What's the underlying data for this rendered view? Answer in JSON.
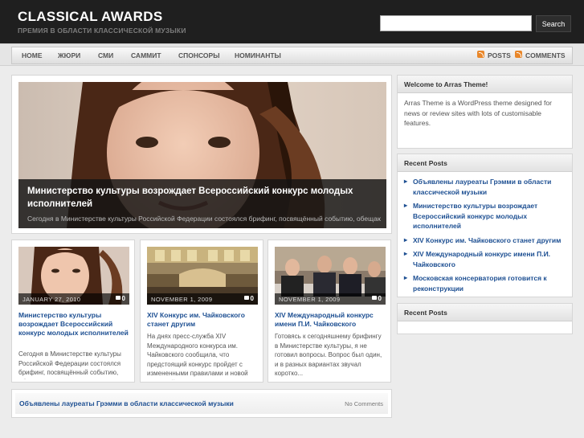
{
  "site": {
    "title": "CLASSICAL AWARDS",
    "description": "ПРЕМИЯ В ОБЛАСТИ КЛАССИЧЕСКОЙ МУЗЫКИ"
  },
  "search": {
    "placeholder": "",
    "button_label": "Search"
  },
  "nav": {
    "items": [
      "HOME",
      "ЖЮРИ",
      "СМИ",
      "САММИТ",
      "СПОНСОРЫ",
      "НОМИНАНТЫ"
    ],
    "feeds": [
      "POSTS",
      "COMMENTS"
    ]
  },
  "featured": {
    "title": "Министерство культуры возрождает Всероссийский конкурс молодых исполнителей",
    "excerpt": "Сегодня в Министерстве культуры Российской Федерации состоялся брифинг, посвящённый событию, обещающему стать одним из самых"
  },
  "posts": [
    {
      "date": "JANUARY 27, 2010",
      "comments": "0",
      "title": "Министерство культуры возрождает Всероссийский конкурс молодых исполнителей",
      "excerpt": "Сегодня в Министерстве культуры Российской Федерации состоялся брифинг, посвящённый событию, обещающему стать одним из самых"
    },
    {
      "date": "NOVEMBER 1, 2009",
      "comments": "0",
      "title": "XIV Конкурс им. Чайковского станет другим",
      "excerpt": "На днях пресс-служба XIV Международного конкурса им. Чайковского сообщила, что предстоящий конкурс пройдет с измененными правилами и новой системой голосования."
    },
    {
      "date": "NOVEMBER 1, 2009",
      "comments": "0",
      "title": "XIV Международный конкурс имени П.И. Чайковского",
      "excerpt": "Готовясь к сегодняшнему брифингу в Министерстве культуры, я не готовил вопросы. Вопрос был один, и в разных вариантах звучал коротко..."
    }
  ],
  "list_post": {
    "title": "Объявлены лауреаты Грэмми в области классической музыки",
    "comments": "No Comments"
  },
  "sidebar": {
    "welcome": {
      "title": "Welcome to Arras Theme!",
      "body": "Arras Theme is a WordPress theme designed for news or review sites with lots of customisable features."
    },
    "recent_posts": {
      "title": "Recent Posts",
      "items": [
        "Объявлены лауреаты Грэмми в области классической музыки",
        "Министерство культуры возрождает Всероссийский конкурс молодых исполнителей",
        "XIV Конкурс им. Чайковского станет другим",
        "XIV Международный конкурс имени П.И. Чайковского",
        "Московская консерватория готовится к реконструкции"
      ]
    },
    "recent_posts_2": {
      "title": "Recent Posts"
    }
  },
  "colors": {
    "header_bg": "#1f1f1f",
    "link": "#1d4f92",
    "rss": "#e9872a"
  }
}
